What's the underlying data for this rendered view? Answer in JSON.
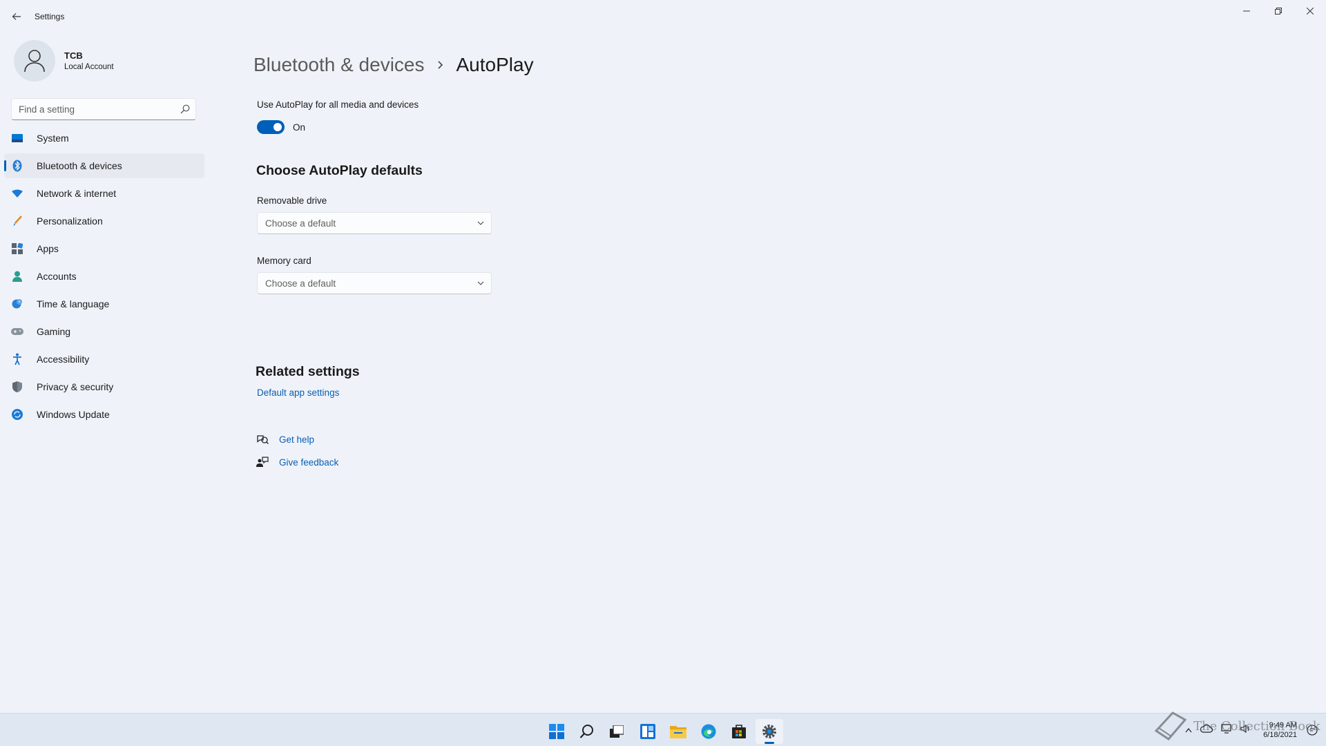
{
  "window": {
    "app_title": "Settings",
    "minimize_icon": "minimize-icon",
    "maximize_icon": "restore-icon",
    "close_icon": "close-icon"
  },
  "profile": {
    "name": "TCB",
    "account_type": "Local Account"
  },
  "search": {
    "placeholder": "Find a setting"
  },
  "sidebar": {
    "items": [
      {
        "label": "System",
        "icon": "monitor-icon",
        "active": false
      },
      {
        "label": "Bluetooth & devices",
        "icon": "bluetooth-icon",
        "active": true
      },
      {
        "label": "Network & internet",
        "icon": "wifi-icon",
        "active": false
      },
      {
        "label": "Personalization",
        "icon": "brush-icon",
        "active": false
      },
      {
        "label": "Apps",
        "icon": "apps-icon",
        "active": false
      },
      {
        "label": "Accounts",
        "icon": "person-icon",
        "active": false
      },
      {
        "label": "Time & language",
        "icon": "globe-clock-icon",
        "active": false
      },
      {
        "label": "Gaming",
        "icon": "gamepad-icon",
        "active": false
      },
      {
        "label": "Accessibility",
        "icon": "accessibility-icon",
        "active": false
      },
      {
        "label": "Privacy & security",
        "icon": "shield-icon",
        "active": false
      },
      {
        "label": "Windows Update",
        "icon": "update-icon",
        "active": false
      }
    ]
  },
  "breadcrumb": {
    "parent": "Bluetooth & devices",
    "current": "AutoPlay"
  },
  "autoplay": {
    "toggle_label": "Use AutoPlay for all media and devices",
    "toggle_state": "On",
    "toggle_on": true
  },
  "defaults": {
    "title": "Choose AutoPlay defaults",
    "removable_label": "Removable drive",
    "removable_value": "Choose a default",
    "memory_label": "Memory card",
    "memory_value": "Choose a default"
  },
  "related": {
    "title": "Related settings",
    "link": "Default app settings"
  },
  "help": {
    "get_help": "Get help",
    "give_feedback": "Give feedback"
  },
  "taskbar": {
    "apps": [
      "start-icon",
      "search-icon",
      "task-view-icon",
      "widgets-icon",
      "file-explorer-icon",
      "edge-icon",
      "store-icon",
      "settings-icon"
    ],
    "active_app": "settings-icon",
    "time": "9:49 AM",
    "date": "6/18/2021"
  },
  "watermark": {
    "text": "The Collection Book"
  },
  "colors": {
    "accent": "#005fb8",
    "background": "#eff3f9",
    "link": "#0a5db3"
  }
}
